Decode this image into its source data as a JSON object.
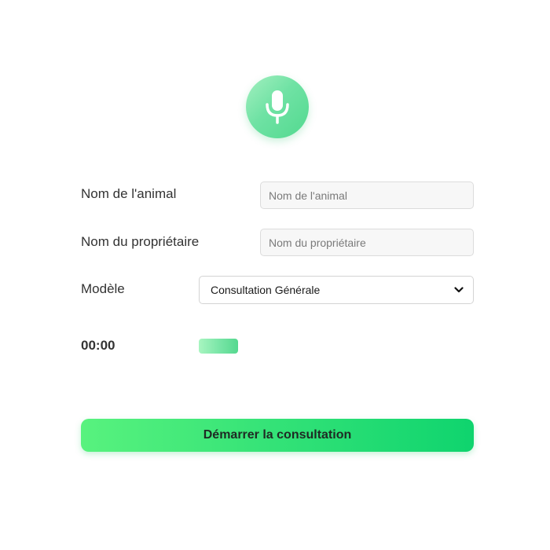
{
  "mic": {
    "icon": "microphone-icon",
    "color_start": "#a4f0c0",
    "color_end": "#52d98f"
  },
  "form": {
    "animal_name": {
      "label": "Nom de l'animal",
      "placeholder": "Nom de l'animal",
      "value": ""
    },
    "owner_name": {
      "label": "Nom du propriétaire",
      "placeholder": "Nom du propriétaire",
      "value": ""
    },
    "model": {
      "label": "Modèle",
      "selected": "Consultation Générale",
      "icon": "chevron-down-icon"
    }
  },
  "recording": {
    "timer": "00:00",
    "level_color": "#7be6a8"
  },
  "actions": {
    "start_label": "Démarrer la consultation",
    "accent": "#33e277"
  }
}
